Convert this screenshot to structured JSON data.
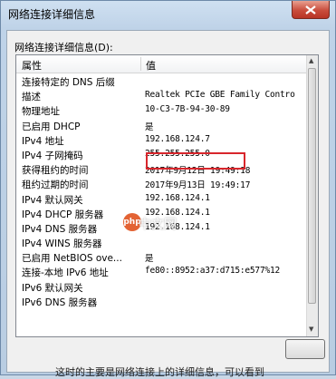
{
  "window": {
    "title": "网络连接详细信息",
    "close_label": "x"
  },
  "group": {
    "label": "网络连接详细信息(D):"
  },
  "columns": {
    "property": "属性",
    "value": "值"
  },
  "rows": [
    {
      "key": "连接特定的 DNS 后缀",
      "value": ""
    },
    {
      "key": "描述",
      "value": "Realtek PCIe GBE Family Contro"
    },
    {
      "key": "物理地址",
      "value": "10-C3-7B-94-30-89"
    },
    {
      "key": "已启用 DHCP",
      "value": "是"
    },
    {
      "key": "IPv4 地址",
      "value": "192.168.124.7"
    },
    {
      "key": "IPv4 子网掩码",
      "value": "255.255.255.0"
    },
    {
      "key": "获得租约的时间",
      "value": "2017年9月12日 19:49:18"
    },
    {
      "key": "租约过期的时间",
      "value": "2017年9月13日 19:49:17"
    },
    {
      "key": "IPv4 默认网关",
      "value": "192.168.124.1"
    },
    {
      "key": "IPv4 DHCP 服务器",
      "value": "192.168.124.1"
    },
    {
      "key": "IPv4 DNS 服务器",
      "value": "192.168.124.1"
    },
    {
      "key": "IPv4 WINS 服务器",
      "value": ""
    },
    {
      "key": "已启用 NetBIOS ove...",
      "value": "是"
    },
    {
      "key": "连接-本地 IPv6 地址",
      "value": "fe80::8952:a37:d715:e577%12"
    },
    {
      "key": "IPv6 默认网关",
      "value": ""
    },
    {
      "key": "IPv6 DNS 服务器",
      "value": ""
    }
  ],
  "buttons": {
    "close": ""
  },
  "watermark": {
    "text": "中文网",
    "logo": "php"
  },
  "footer": {
    "text": "这时的主要是网络连接上的详细信息，可以看到"
  },
  "colors": {
    "highlight": "#d8262c",
    "close_button": "#c94d3c"
  }
}
